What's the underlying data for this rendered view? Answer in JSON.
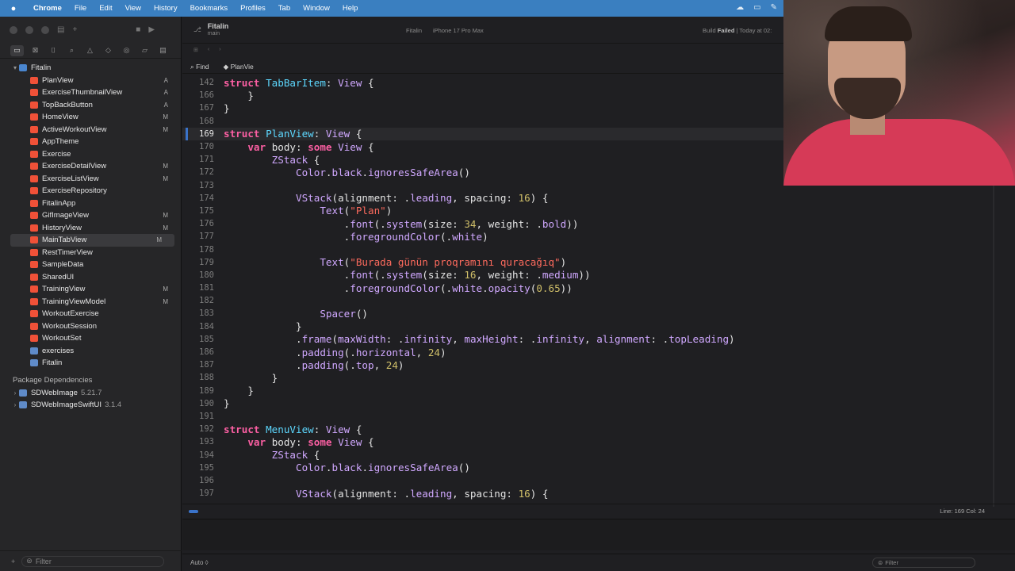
{
  "menubar": {
    "app": "Chrome",
    "items": [
      "File",
      "Edit",
      "View",
      "History",
      "Bookmarks",
      "Profiles",
      "Tab",
      "Window",
      "Help"
    ]
  },
  "navigator": {
    "project": "Fitalin",
    "files": [
      {
        "name": "PlanView",
        "status": "A"
      },
      {
        "name": "ExerciseThumbnailView",
        "status": "A"
      },
      {
        "name": "TopBackButton",
        "status": "A"
      },
      {
        "name": "HomeView",
        "status": "M"
      },
      {
        "name": "ActiveWorkoutView",
        "status": "M"
      },
      {
        "name": "AppTheme",
        "status": ""
      },
      {
        "name": "Exercise",
        "status": ""
      },
      {
        "name": "ExerciseDetailView",
        "status": "M"
      },
      {
        "name": "ExerciseListView",
        "status": "M"
      },
      {
        "name": "ExerciseRepository",
        "status": ""
      },
      {
        "name": "FitalinApp",
        "status": ""
      },
      {
        "name": "GifImageView",
        "status": "M"
      },
      {
        "name": "HistoryView",
        "status": "M"
      },
      {
        "name": "MainTabView",
        "status": "M",
        "selected": true
      },
      {
        "name": "RestTimerView",
        "status": ""
      },
      {
        "name": "SampleData",
        "status": ""
      },
      {
        "name": "SharedUI",
        "status": ""
      },
      {
        "name": "TrainingView",
        "status": "M"
      },
      {
        "name": "TrainingViewModel",
        "status": "M"
      },
      {
        "name": "WorkoutExercise",
        "status": ""
      },
      {
        "name": "WorkoutSession",
        "status": ""
      },
      {
        "name": "WorkoutSet",
        "status": ""
      },
      {
        "name": "exercises",
        "status": ""
      },
      {
        "name": "Fitalin",
        "status": ""
      }
    ],
    "package_header": "Package Dependencies",
    "packages": [
      {
        "name": "SDWebImage",
        "version": "5.21.7"
      },
      {
        "name": "SDWebImageSwiftUI",
        "version": "3.1.4"
      }
    ],
    "filter_placeholder": "Filter"
  },
  "editor": {
    "title": "Fitalin",
    "branch": "main",
    "scheme": "Fitalin",
    "device": "iPhone 17 Pro Max",
    "build_prefix": "Build ",
    "build_state": "Failed",
    "build_time": " | Today at 02:",
    "find_label": "Find",
    "find_text": "PlanVie",
    "cursor_position": "Line: 169  Col: 24",
    "auto_label": "Auto ◊",
    "filter_placeholder": "Filter"
  },
  "code": [
    {
      "n": "142",
      "tokens": [
        [
          "kw",
          "struct "
        ],
        [
          "type",
          "TabBarItem"
        ],
        [
          "plain",
          ": "
        ],
        [
          "sys",
          "View"
        ],
        [
          "plain",
          " {"
        ]
      ]
    },
    {
      "n": "166",
      "tokens": [
        [
          "plain",
          "    }"
        ]
      ]
    },
    {
      "n": "167",
      "tokens": [
        [
          "plain",
          "}"
        ]
      ]
    },
    {
      "n": "168",
      "tokens": []
    },
    {
      "n": "169",
      "current": true,
      "tokens": [
        [
          "kw",
          "struct "
        ],
        [
          "type",
          "PlanView"
        ],
        [
          "plain",
          ": "
        ],
        [
          "sys",
          "View"
        ],
        [
          "plain",
          " {"
        ]
      ]
    },
    {
      "n": "170",
      "tokens": [
        [
          "plain",
          "    "
        ],
        [
          "kw",
          "var "
        ],
        [
          "plain",
          "body: "
        ],
        [
          "kw",
          "some "
        ],
        [
          "sys",
          "View"
        ],
        [
          "plain",
          " {"
        ]
      ]
    },
    {
      "n": "171",
      "tokens": [
        [
          "plain",
          "        "
        ],
        [
          "sys",
          "ZStack"
        ],
        [
          "plain",
          " {"
        ]
      ]
    },
    {
      "n": "172",
      "tokens": [
        [
          "plain",
          "            "
        ],
        [
          "sys",
          "Color"
        ],
        [
          "plain",
          "."
        ],
        [
          "sys",
          "black"
        ],
        [
          "plain",
          "."
        ],
        [
          "sys",
          "ignoresSafeArea"
        ],
        [
          "plain",
          "()"
        ]
      ]
    },
    {
      "n": "173",
      "tokens": []
    },
    {
      "n": "174",
      "tokens": [
        [
          "plain",
          "            "
        ],
        [
          "sys",
          "VStack"
        ],
        [
          "plain",
          "(alignment: ."
        ],
        [
          "sys",
          "leading"
        ],
        [
          "plain",
          ", spacing: "
        ],
        [
          "num",
          "16"
        ],
        [
          "plain",
          ") {"
        ]
      ]
    },
    {
      "n": "175",
      "tokens": [
        [
          "plain",
          "                "
        ],
        [
          "sys",
          "Text"
        ],
        [
          "plain",
          "("
        ],
        [
          "str",
          "\"Plan\""
        ],
        [
          "plain",
          ")"
        ]
      ]
    },
    {
      "n": "176",
      "tokens": [
        [
          "plain",
          "                    ."
        ],
        [
          "sys",
          "font"
        ],
        [
          "plain",
          "(."
        ],
        [
          "sys",
          "system"
        ],
        [
          "plain",
          "(size: "
        ],
        [
          "num",
          "34"
        ],
        [
          "plain",
          ", weight: ."
        ],
        [
          "sys",
          "bold"
        ],
        [
          "plain",
          "))"
        ]
      ]
    },
    {
      "n": "177",
      "tokens": [
        [
          "plain",
          "                    ."
        ],
        [
          "sys",
          "foregroundColor"
        ],
        [
          "plain",
          "(."
        ],
        [
          "sys",
          "white"
        ],
        [
          "plain",
          ")"
        ]
      ]
    },
    {
      "n": "178",
      "tokens": []
    },
    {
      "n": "179",
      "tokens": [
        [
          "plain",
          "                "
        ],
        [
          "sys",
          "Text"
        ],
        [
          "plain",
          "("
        ],
        [
          "str",
          "\"Burada günün proqramını quracağıq\""
        ],
        [
          "plain",
          ")"
        ]
      ]
    },
    {
      "n": "180",
      "tokens": [
        [
          "plain",
          "                    ."
        ],
        [
          "sys",
          "font"
        ],
        [
          "plain",
          "(."
        ],
        [
          "sys",
          "system"
        ],
        [
          "plain",
          "(size: "
        ],
        [
          "num",
          "16"
        ],
        [
          "plain",
          ", weight: ."
        ],
        [
          "sys",
          "medium"
        ],
        [
          "plain",
          "))"
        ]
      ]
    },
    {
      "n": "181",
      "tokens": [
        [
          "plain",
          "                    ."
        ],
        [
          "sys",
          "foregroundColor"
        ],
        [
          "plain",
          "(."
        ],
        [
          "sys",
          "white"
        ],
        [
          "plain",
          "."
        ],
        [
          "sys",
          "opacity"
        ],
        [
          "plain",
          "("
        ],
        [
          "num",
          "0.65"
        ],
        [
          "plain",
          "))"
        ]
      ]
    },
    {
      "n": "182",
      "tokens": []
    },
    {
      "n": "183",
      "tokens": [
        [
          "plain",
          "                "
        ],
        [
          "sys",
          "Spacer"
        ],
        [
          "plain",
          "()"
        ]
      ]
    },
    {
      "n": "184",
      "tokens": [
        [
          "plain",
          "            }"
        ]
      ]
    },
    {
      "n": "185",
      "tokens": [
        [
          "plain",
          "            ."
        ],
        [
          "sys",
          "frame"
        ],
        [
          "plain",
          "("
        ],
        [
          "sys",
          "maxWidth"
        ],
        [
          "plain",
          ": ."
        ],
        [
          "sys",
          "infinity"
        ],
        [
          "plain",
          ", "
        ],
        [
          "sys",
          "maxHeight"
        ],
        [
          "plain",
          ": ."
        ],
        [
          "sys",
          "infinity"
        ],
        [
          "plain",
          ", "
        ],
        [
          "sys",
          "alignment"
        ],
        [
          "plain",
          ": ."
        ],
        [
          "sys",
          "topLeading"
        ],
        [
          "plain",
          ")"
        ]
      ]
    },
    {
      "n": "186",
      "tokens": [
        [
          "plain",
          "            ."
        ],
        [
          "sys",
          "padding"
        ],
        [
          "plain",
          "(."
        ],
        [
          "sys",
          "horizontal"
        ],
        [
          "plain",
          ", "
        ],
        [
          "num",
          "24"
        ],
        [
          "plain",
          ")"
        ]
      ]
    },
    {
      "n": "187",
      "tokens": [
        [
          "plain",
          "            ."
        ],
        [
          "sys",
          "padding"
        ],
        [
          "plain",
          "(."
        ],
        [
          "sys",
          "top"
        ],
        [
          "plain",
          ", "
        ],
        [
          "num",
          "24"
        ],
        [
          "plain",
          ")"
        ]
      ]
    },
    {
      "n": "188",
      "tokens": [
        [
          "plain",
          "        }"
        ]
      ]
    },
    {
      "n": "189",
      "tokens": [
        [
          "plain",
          "    }"
        ]
      ]
    },
    {
      "n": "190",
      "tokens": [
        [
          "plain",
          "}"
        ]
      ]
    },
    {
      "n": "191",
      "tokens": []
    },
    {
      "n": "192",
      "tokens": [
        [
          "kw",
          "struct "
        ],
        [
          "type",
          "MenuView"
        ],
        [
          "plain",
          ": "
        ],
        [
          "sys",
          "View"
        ],
        [
          "plain",
          " {"
        ]
      ]
    },
    {
      "n": "193",
      "tokens": [
        [
          "plain",
          "    "
        ],
        [
          "kw",
          "var "
        ],
        [
          "plain",
          "body: "
        ],
        [
          "kw",
          "some "
        ],
        [
          "sys",
          "View"
        ],
        [
          "plain",
          " {"
        ]
      ]
    },
    {
      "n": "194",
      "tokens": [
        [
          "plain",
          "        "
        ],
        [
          "sys",
          "ZStack"
        ],
        [
          "plain",
          " {"
        ]
      ]
    },
    {
      "n": "195",
      "tokens": [
        [
          "plain",
          "            "
        ],
        [
          "sys",
          "Color"
        ],
        [
          "plain",
          "."
        ],
        [
          "sys",
          "black"
        ],
        [
          "plain",
          "."
        ],
        [
          "sys",
          "ignoresSafeArea"
        ],
        [
          "plain",
          "()"
        ]
      ]
    },
    {
      "n": "196",
      "tokens": []
    },
    {
      "n": "197",
      "tokens": [
        [
          "plain",
          "            "
        ],
        [
          "sys",
          "VStack"
        ],
        [
          "plain",
          "(alignment: ."
        ],
        [
          "sys",
          "leading"
        ],
        [
          "plain",
          ", spacing: "
        ],
        [
          "num",
          "16"
        ],
        [
          "plain",
          ") {"
        ]
      ]
    }
  ],
  "colors": {
    "keyword": "#fc5fa3",
    "type_decl": "#5dd8ff",
    "system": "#d0a8ff",
    "string": "#fc6a5d",
    "number": "#d0bf69",
    "menubar": "#3a7fc0",
    "webcam_shirt": "#d63a57"
  }
}
